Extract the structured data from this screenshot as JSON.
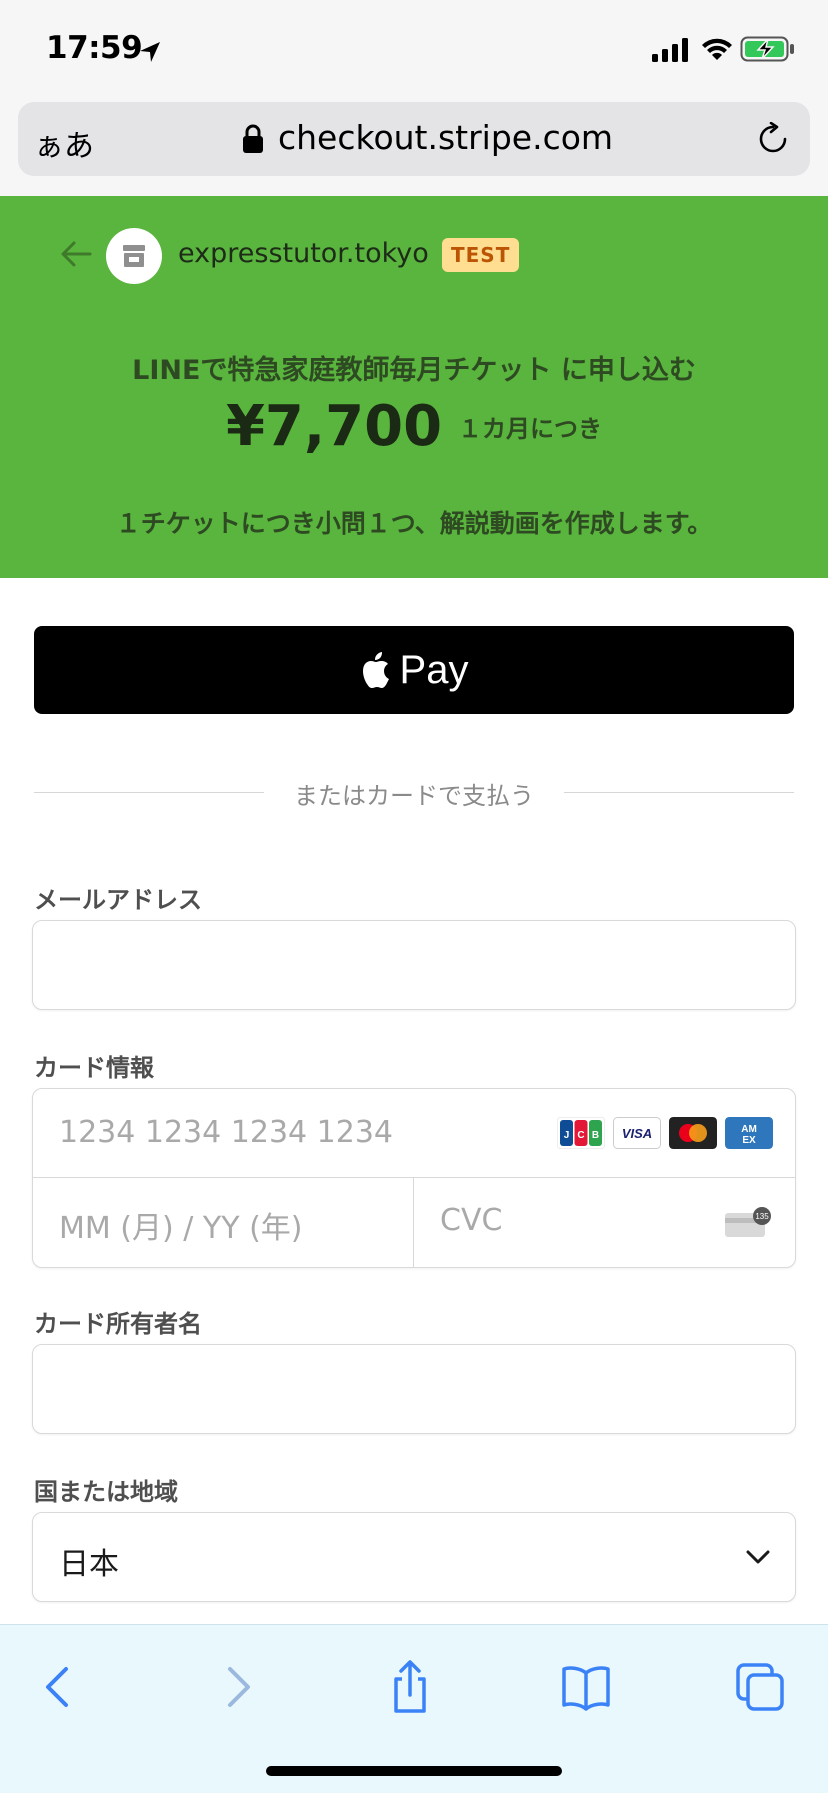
{
  "status_bar": {
    "time": "17:59"
  },
  "browser": {
    "text_size_label": "ぁあ",
    "url": "checkout.stripe.com"
  },
  "header": {
    "merchant": "expresstutor.tokyo",
    "badge": "TEST",
    "product": "LINEで特急家庭教師毎月チケット に申し込む",
    "price": "¥7,700",
    "period": "１カ月につき",
    "description": "１チケットにつき小問１つ、解説動画を作成します。"
  },
  "payment": {
    "apple_pay_label": "Pay",
    "divider_text": "またはカードで支払う"
  },
  "form": {
    "email_label": "メールアドレス",
    "card_label": "カード情報",
    "card_number_placeholder": "1234 1234 1234 1234",
    "expiry_placeholder": "MM (月) / YY (年)",
    "cvc_placeholder": "CVC",
    "card_brands": [
      "JCB",
      "VISA",
      "Mastercard",
      "AMEX"
    ],
    "cvc_hint": "135",
    "name_label": "カード所有者名",
    "country_label": "国または地域",
    "country_value": "日本"
  },
  "colors": {
    "header_bg": "#59b53d",
    "badge_bg": "#ffde92",
    "toolbar_accent": "#3a82f6"
  }
}
